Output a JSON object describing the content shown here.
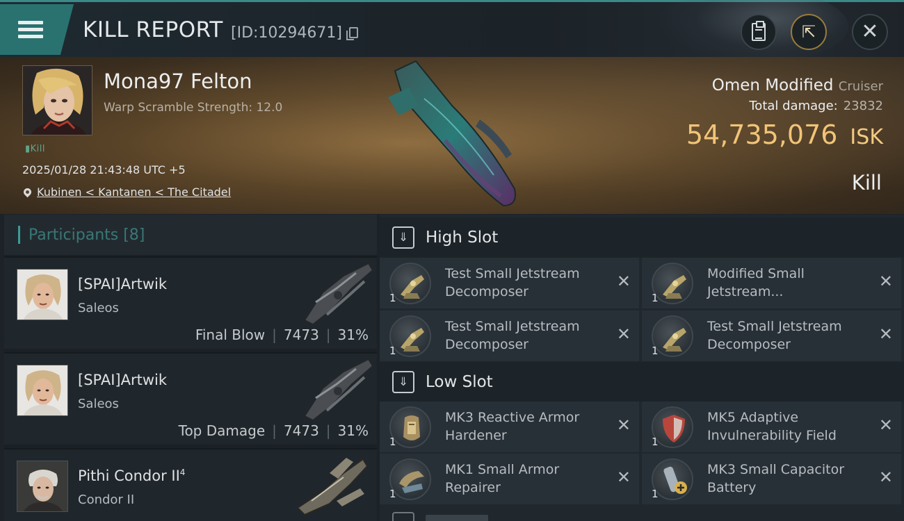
{
  "header": {
    "title": "KILL REPORT",
    "report_id": "[ID:10294671]"
  },
  "victim": {
    "name": "Mona97 Felton",
    "warp_scramble": "Warp Scramble Strength: 12.0",
    "tag": "Kill",
    "timestamp": "2025/01/28 21:43:48 UTC +5",
    "location": "Kubinen < Kantanen < The Citadel",
    "ship_name": "Omen Modified",
    "ship_class": "Cruiser",
    "damage_label": "Total damage:",
    "damage_value": "23832",
    "isk_value": "54,735,076",
    "isk_unit": "ISK",
    "result": "Kill"
  },
  "participants": {
    "header": "Participants [8]",
    "items": [
      {
        "name": "[SPAI]Artwik",
        "ship": "Saleos",
        "role": "Final Blow",
        "damage": "7473",
        "percent": "31%"
      },
      {
        "name": "[SPAI]Artwik",
        "ship": "Saleos",
        "role": "Top Damage",
        "damage": "7473",
        "percent": "31%"
      },
      {
        "name": "Pithi Condor II",
        "ship": "Condor II",
        "superscript": "4"
      }
    ]
  },
  "fitting": {
    "high_slot": {
      "title": "High Slot",
      "modules": [
        {
          "name": "Test Small Jetstream Decomposer",
          "qty": "1"
        },
        {
          "name": "Modified Small Jetstream...",
          "qty": "1"
        },
        {
          "name": "Test Small Jetstream Decomposer",
          "qty": "1"
        },
        {
          "name": "Test Small Jetstream Decomposer",
          "qty": "1"
        }
      ]
    },
    "low_slot": {
      "title": "Low Slot",
      "modules": [
        {
          "name": "MK3 Reactive Armor Hardener",
          "qty": "1"
        },
        {
          "name": "MK5 Adaptive Invulnerability Field",
          "qty": "1"
        },
        {
          "name": "MK1 Small Armor Repairer",
          "qty": "1"
        },
        {
          "name": "MK3 Small Capacitor Battery",
          "qty": "1"
        }
      ]
    }
  },
  "colors": {
    "accent_teal": "#2a7270",
    "isk_gold": "#f2c477",
    "panel_dark": "#1f262c"
  },
  "icons": [
    "menu-icon",
    "copy-icon",
    "clipboard-icon",
    "share-icon",
    "close-icon",
    "pin-icon",
    "slot-icon",
    "remove-icon"
  ]
}
